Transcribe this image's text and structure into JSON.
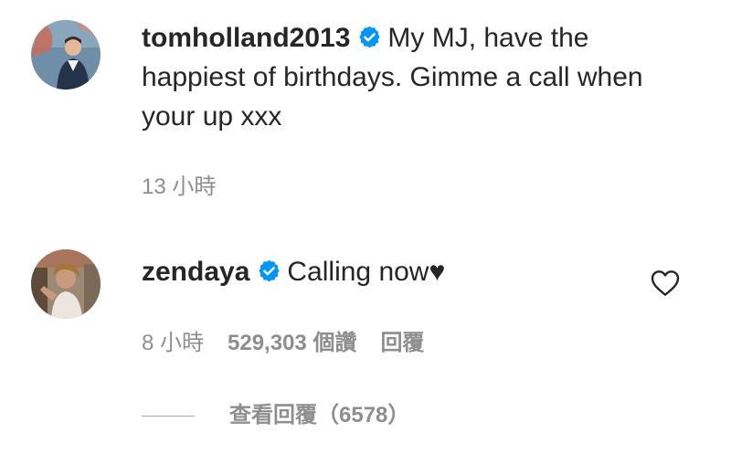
{
  "comments": [
    {
      "username": "tomholland2013",
      "text": "My MJ, have the happiest of birthdays. Gimme a call when your up xxx",
      "time": "13 小時",
      "verified_icon": "verified-badge-icon"
    },
    {
      "username": "zendaya",
      "text": "Calling now♥",
      "time": "8 小時",
      "likes": "529,303 個讚",
      "reply_label": "回覆",
      "like_icon": "heart-outline-icon",
      "verified_icon": "verified-badge-icon"
    }
  ],
  "view_replies": {
    "label": "查看回覆（6578）"
  },
  "colors": {
    "text": "#262626",
    "secondary": "#8e8e8e",
    "verified": "#0095f6"
  }
}
